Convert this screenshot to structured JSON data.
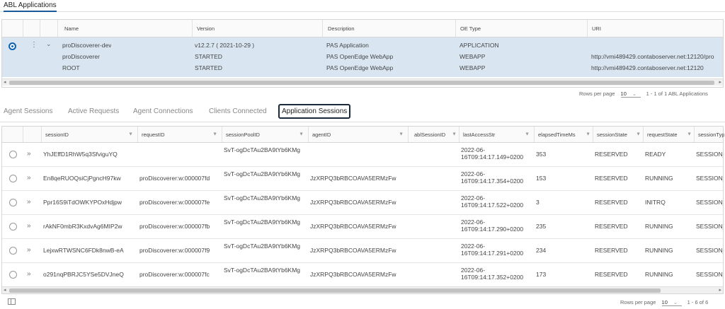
{
  "topnav": {
    "tab": "ABL Applications"
  },
  "app_grid": {
    "headers": [
      "Name",
      "Version",
      "Description",
      "OE Type",
      "URI"
    ],
    "rows": [
      {
        "name": "proDiscoverer-dev",
        "version": "v12.2.7 ( 2021-10-29 )",
        "description": "PAS Application",
        "oe_type": "APPLICATION",
        "uri": ""
      },
      {
        "name": "proDiscoverer",
        "version": "STARTED",
        "description": "PAS OpenEdge WebApp",
        "oe_type": "WEBAPP",
        "uri": "http://vmi489429.contaboserver.net:12120/pro"
      },
      {
        "name": "ROOT",
        "version": "STARTED",
        "description": "PAS OpenEdge WebApp",
        "oe_type": "WEBAPP",
        "uri": "http://vmi489429.contaboserver.net:12120"
      }
    ],
    "kebab_icon": "⋮",
    "chevron_icon": "⌄",
    "pager": {
      "rows_label": "Rows per page",
      "rows_value": "10",
      "range": "1 - 1 of 1 ABL Applications"
    }
  },
  "tabs": [
    "Agent Sessions",
    "Active Requests",
    "Agent Connections",
    "Clients Connected",
    "Application Sessions"
  ],
  "sess_grid": {
    "headers": [
      "sessionID",
      "requestID",
      "sessionPoolID",
      "agentID",
      "ablSessionID",
      "lastAccessStr",
      "elapsedTimeMs",
      "sessionState",
      "requestState",
      "sessionTyp"
    ],
    "filter_icon": "▼",
    "expand_icon": "»",
    "rows": [
      {
        "sessionID": "YhJEffD1RhW5q3SfviguYQ",
        "requestID": "",
        "sessionPoolID": "SvT-ogDcTAu2BA9tYb6KMg",
        "agentID": "",
        "ablSessionID": "",
        "lastAccessStr": "2022-06-16T09:14:17.149+0200",
        "elapsedTimeMs": "353",
        "sessionState": "RESERVED",
        "requestState": "READY",
        "sessionType": "SESSION_"
      },
      {
        "sessionID": "En8qeRUOQsiCjPgncH97kw",
        "requestID": "proDiscoverer:w:000007fd",
        "sessionPoolID": "SvT-ogDcTAu2BA9tYb6KMg",
        "agentID": "JzXRPQ3bRBCOAVA5ERMzFw",
        "ablSessionID": "",
        "lastAccessStr": "2022-06-16T09:14:17.354+0200",
        "elapsedTimeMs": "153",
        "sessionState": "RESERVED",
        "requestState": "RUNNING",
        "sessionType": "SESSION_"
      },
      {
        "sessionID": "Ppr16S9iTdOWKYPOxHdjpw",
        "requestID": "proDiscoverer:w:000007fe",
        "sessionPoolID": "SvT-ogDcTAu2BA9tYb6KMg",
        "agentID": "JzXRPQ3bRBCOAVA5ERMzFw",
        "ablSessionID": "",
        "lastAccessStr": "2022-06-16T09:14:17.522+0200",
        "elapsedTimeMs": "3",
        "sessionState": "RESERVED",
        "requestState": "INITRQ",
        "sessionType": "SESSION_"
      },
      {
        "sessionID": "rAkNF0mbR3KxdvAg6MIP2w",
        "requestID": "proDiscoverer:w:000007fb",
        "sessionPoolID": "SvT-ogDcTAu2BA9tYb6KMg",
        "agentID": "JzXRPQ3bRBCOAVA5ERMzFw",
        "ablSessionID": "",
        "lastAccessStr": "2022-06-16T09:14:17.290+0200",
        "elapsedTimeMs": "235",
        "sessionState": "RESERVED",
        "requestState": "RUNNING",
        "sessionType": "SESSION_"
      },
      {
        "sessionID": "LejxwRTWSNC6FDk8nwB-eA",
        "requestID": "proDiscoverer:w:000007f9",
        "sessionPoolID": "SvT-ogDcTAu2BA9tYb6KMg",
        "agentID": "JzXRPQ3bRBCOAVA5ERMzFw",
        "ablSessionID": "",
        "lastAccessStr": "2022-06-16T09:14:17.291+0200",
        "elapsedTimeMs": "234",
        "sessionState": "RESERVED",
        "requestState": "RUNNING",
        "sessionType": "SESSION_"
      },
      {
        "sessionID": "o291nqPBRJC5YSe5DVJneQ",
        "requestID": "proDiscoverer:w:000007fc",
        "sessionPoolID": "SvT-ogDcTAu2BA9tYb6KMg",
        "agentID": "JzXRPQ3bRBCOAVA5ERMzFw",
        "ablSessionID": "",
        "lastAccessStr": "2022-06-16T09:14:17.352+0200",
        "elapsedTimeMs": "173",
        "sessionState": "RESERVED",
        "requestState": "RUNNING",
        "sessionType": "SESSION_"
      }
    ],
    "pager": {
      "rows_label": "Rows per page",
      "rows_value": "10",
      "range": "1 - 6 of 6"
    }
  },
  "colors": {
    "accent": "#0e63b3",
    "selected_row": "#d9e6f2",
    "active_tab_border": "#1b2a3a"
  },
  "icons": {
    "radio": "radio-icon",
    "kebab": "kebab-icon",
    "chevron": "chevron-down-icon",
    "filter": "filter-icon",
    "expand": "expand-icon",
    "column_toggle": "column-toggle-icon"
  }
}
